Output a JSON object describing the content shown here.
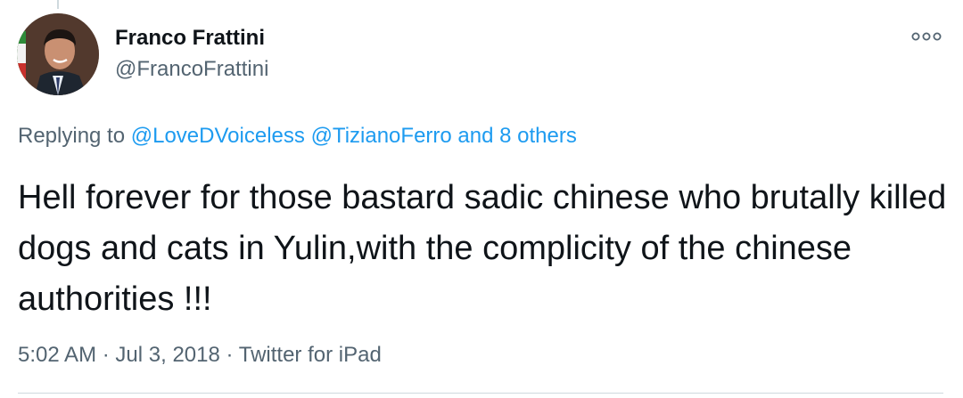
{
  "tweet": {
    "author": {
      "display_name": "Franco Frattini",
      "handle": "@FrancoFrattini",
      "avatar_icon": "person-photo"
    },
    "more_icon": "more-options-icon",
    "reply": {
      "prefix": "Replying to",
      "mention_1": "@LoveDVoiceless",
      "mention_2": "@TizianoFerro",
      "others": "and 8 others"
    },
    "text": "Hell forever for those bastard sadic chinese who brutally killed dogs and cats in Yulin,with the complicity of the chinese authorities !!!",
    "meta": {
      "time": "5:02 AM",
      "date": "Jul 3, 2018",
      "source": "Twitter for iPad",
      "separator": "·"
    }
  },
  "colors": {
    "text": "#0f1419",
    "secondary": "#536471",
    "link": "#1d9bf0",
    "divider": "#cfd9de"
  }
}
